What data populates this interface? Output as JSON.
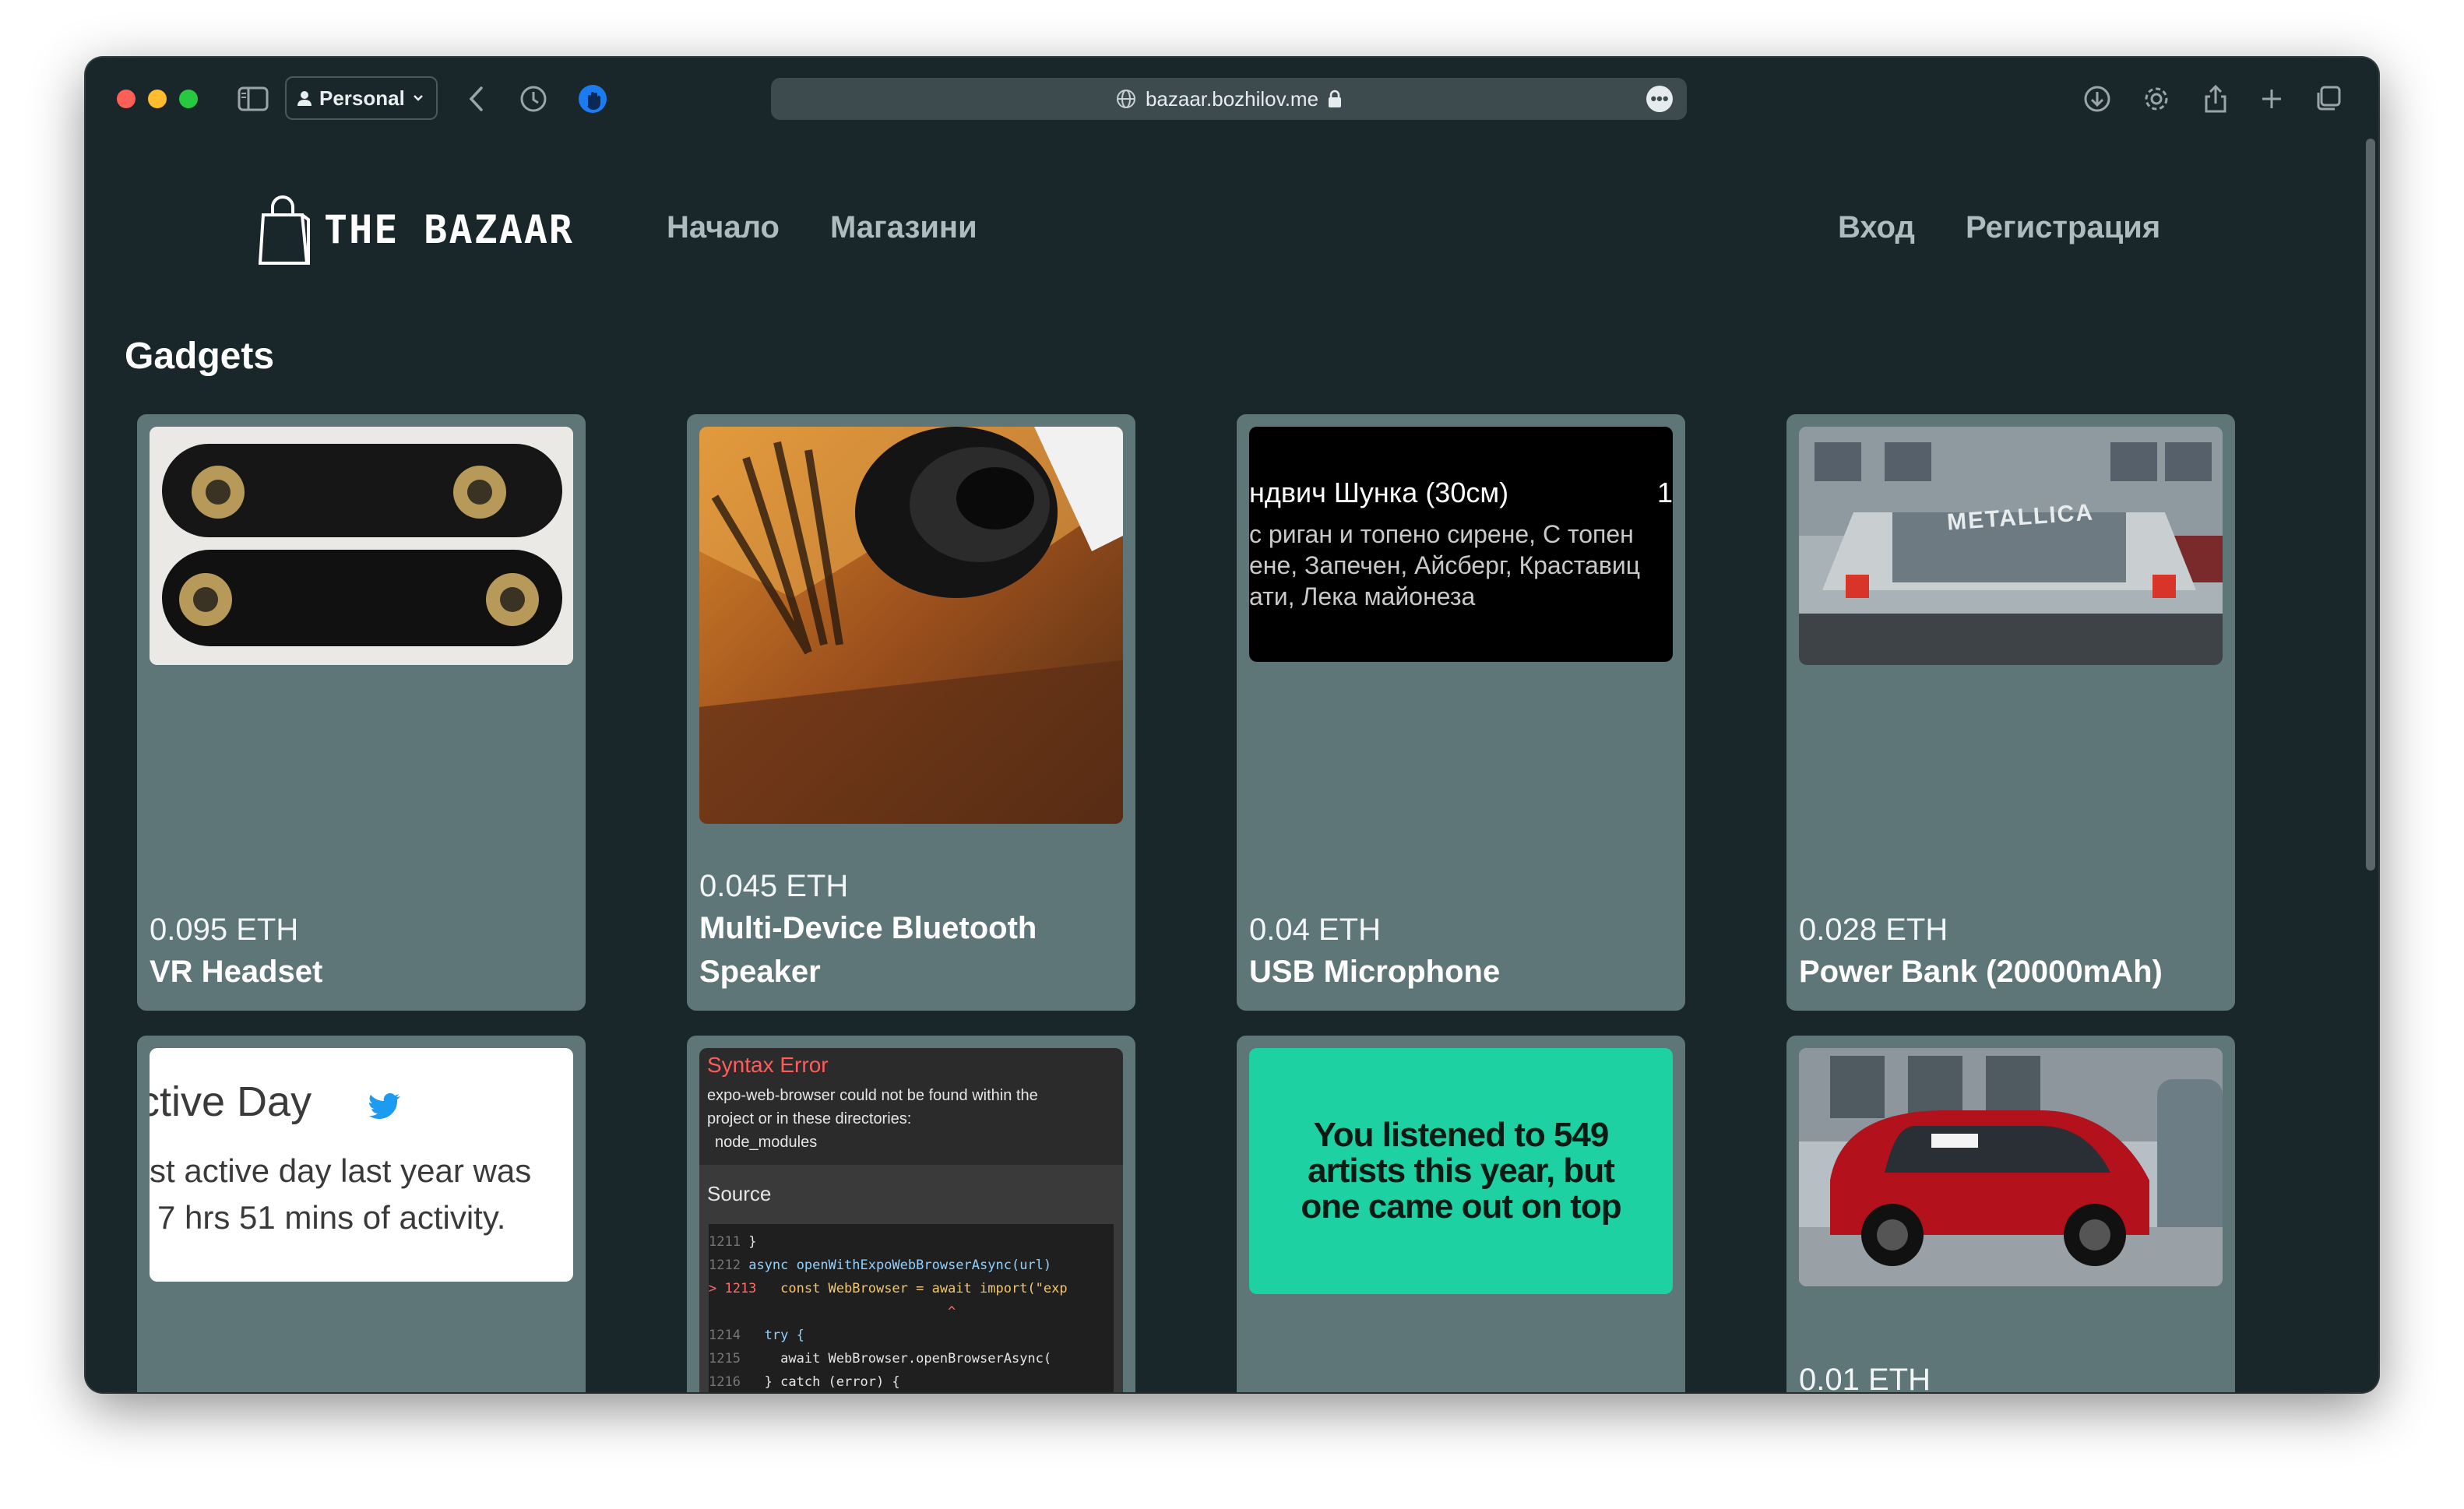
{
  "browser": {
    "profile_label": "Personal",
    "address": "bazaar.bozhilov.me",
    "address_more": "•••"
  },
  "site": {
    "logo_text": "THE BAZAAR",
    "nav_home": "Начало",
    "nav_stores": "Магазини",
    "nav_login": "Вход",
    "nav_register": "Регистрация"
  },
  "section_title": "Gadgets",
  "products": [
    {
      "price": "0.095 ETH",
      "name": "VR Headset"
    },
    {
      "price": "0.045 ETH",
      "name": "Multi-Device Bluetooth Speaker"
    },
    {
      "price": "0.04 ETH",
      "name": "USB Microphone"
    },
    {
      "price": "0.028 ETH",
      "name": "Power Bank (20000mAh)"
    },
    {
      "price": "",
      "name": ""
    },
    {
      "price": "",
      "name": ""
    },
    {
      "price": "",
      "name": ""
    },
    {
      "price": "0.01 ETH",
      "name": ""
    }
  ],
  "image_texts": {
    "menu_line1": "ндвич Шунка (30см)",
    "menu_line1_right": "1",
    "menu_line2": "с риган и топено сирене, С топен",
    "menu_line3": "ене, Запечен, Айсберг, Краставиц",
    "menu_line4": "ати, Лека майонеза",
    "car_window_text": "METALLICA",
    "tweet_title": "ctive Day",
    "tweet_line1": "st active day last year was",
    "tweet_line2": "7 hrs 51 mins of activity.",
    "error_title": "Syntax Error",
    "error_line1": "expo-web-browser could not be found within the",
    "error_line2": "project or in these directories:",
    "error_line3": "node_modules",
    "error_source": "Source",
    "code_lines": [
      {
        "num": "1211",
        "code": "}"
      },
      {
        "num": "1212",
        "code": "async openWithExpoWebBrowserAsync(url)"
      },
      {
        "num": "> 1213",
        "code": "  const WebBrowser = await import(\"exp"
      },
      {
        "num": "",
        "code": "                              ^"
      },
      {
        "num": "1214",
        "code": "  try {"
      },
      {
        "num": "1215",
        "code": "    await WebBrowser.openBrowserAsync("
      },
      {
        "num": "1216",
        "code": "  } catch (error) {"
      }
    ],
    "spotify_text": "You listened to 549 artists this year, but one came out on top"
  },
  "colors": {
    "page_bg": "#19262a",
    "card_bg": "#5f7679",
    "nav_text": "#aebbbf",
    "spotify_green": "#1ed1a2",
    "error_red": "#ff6b6b"
  }
}
